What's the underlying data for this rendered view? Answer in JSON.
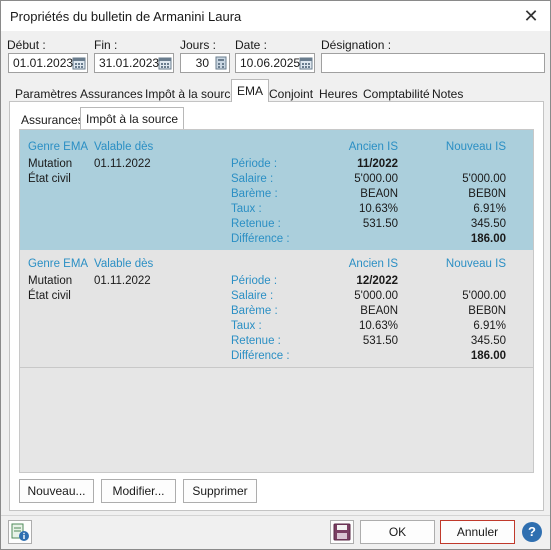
{
  "title": "Propriétés du bulletin de Armanini Laura",
  "fields": {
    "debut_label": "Début :",
    "debut_value": "01.01.2023",
    "fin_label": "Fin :",
    "fin_value": "31.01.2023",
    "jours_label": "Jours :",
    "jours_value": "30",
    "date_label": "Date :",
    "date_value": "10.06.2025",
    "designation_label": "Désignation :",
    "designation_value": ""
  },
  "tabs": [
    "Paramètres",
    "Assurances",
    "Impôt à la source",
    "EMA",
    "Conjoint",
    "Heures",
    "Comptabilité",
    "Notes"
  ],
  "subtabs": [
    "Assurances",
    "Impôt à la source"
  ],
  "headers": {
    "genre": "Genre EMA",
    "valable": "Valable dès",
    "ancien": "Ancien IS",
    "nouveau": "Nouveau IS"
  },
  "rows": [
    {
      "genre1": "Mutation",
      "genre2": "État civil",
      "valable": "01.11.2022",
      "periode_label": "Période :",
      "periode": "11/2022",
      "salaire_label": "Salaire :",
      "salaire_old": "5'000.00",
      "salaire_new": "5'000.00",
      "bareme_label": "Barème :",
      "bareme_old": "BEA0N",
      "bareme_new": "BEB0N",
      "taux_label": "Taux :",
      "taux_old": "10.63%",
      "taux_new": "6.91%",
      "retenue_label": "Retenue :",
      "retenue_old": "531.50",
      "retenue_new": "345.50",
      "diff_label": "Différence :",
      "diff": "186.00"
    },
    {
      "genre1": "Mutation",
      "genre2": "État civil",
      "valable": "01.11.2022",
      "periode_label": "Période :",
      "periode": "12/2022",
      "salaire_label": "Salaire :",
      "salaire_old": "5'000.00",
      "salaire_new": "5'000.00",
      "bareme_label": "Barème :",
      "bareme_old": "BEA0N",
      "bareme_new": "BEB0N",
      "taux_label": "Taux :",
      "taux_old": "10.63%",
      "taux_new": "6.91%",
      "retenue_label": "Retenue :",
      "retenue_old": "531.50",
      "retenue_new": "345.50",
      "diff_label": "Différence :",
      "diff": "186.00"
    }
  ],
  "buttons": {
    "nouveau": "Nouveau...",
    "modifier": "Modifier...",
    "supprimer": "Supprimer",
    "ok": "OK",
    "annuler": "Annuler",
    "help": "?"
  },
  "colors": {
    "accent": "#2b8fc4",
    "selected_row": "#abcfdc",
    "cancel_border": "#c0392b"
  }
}
